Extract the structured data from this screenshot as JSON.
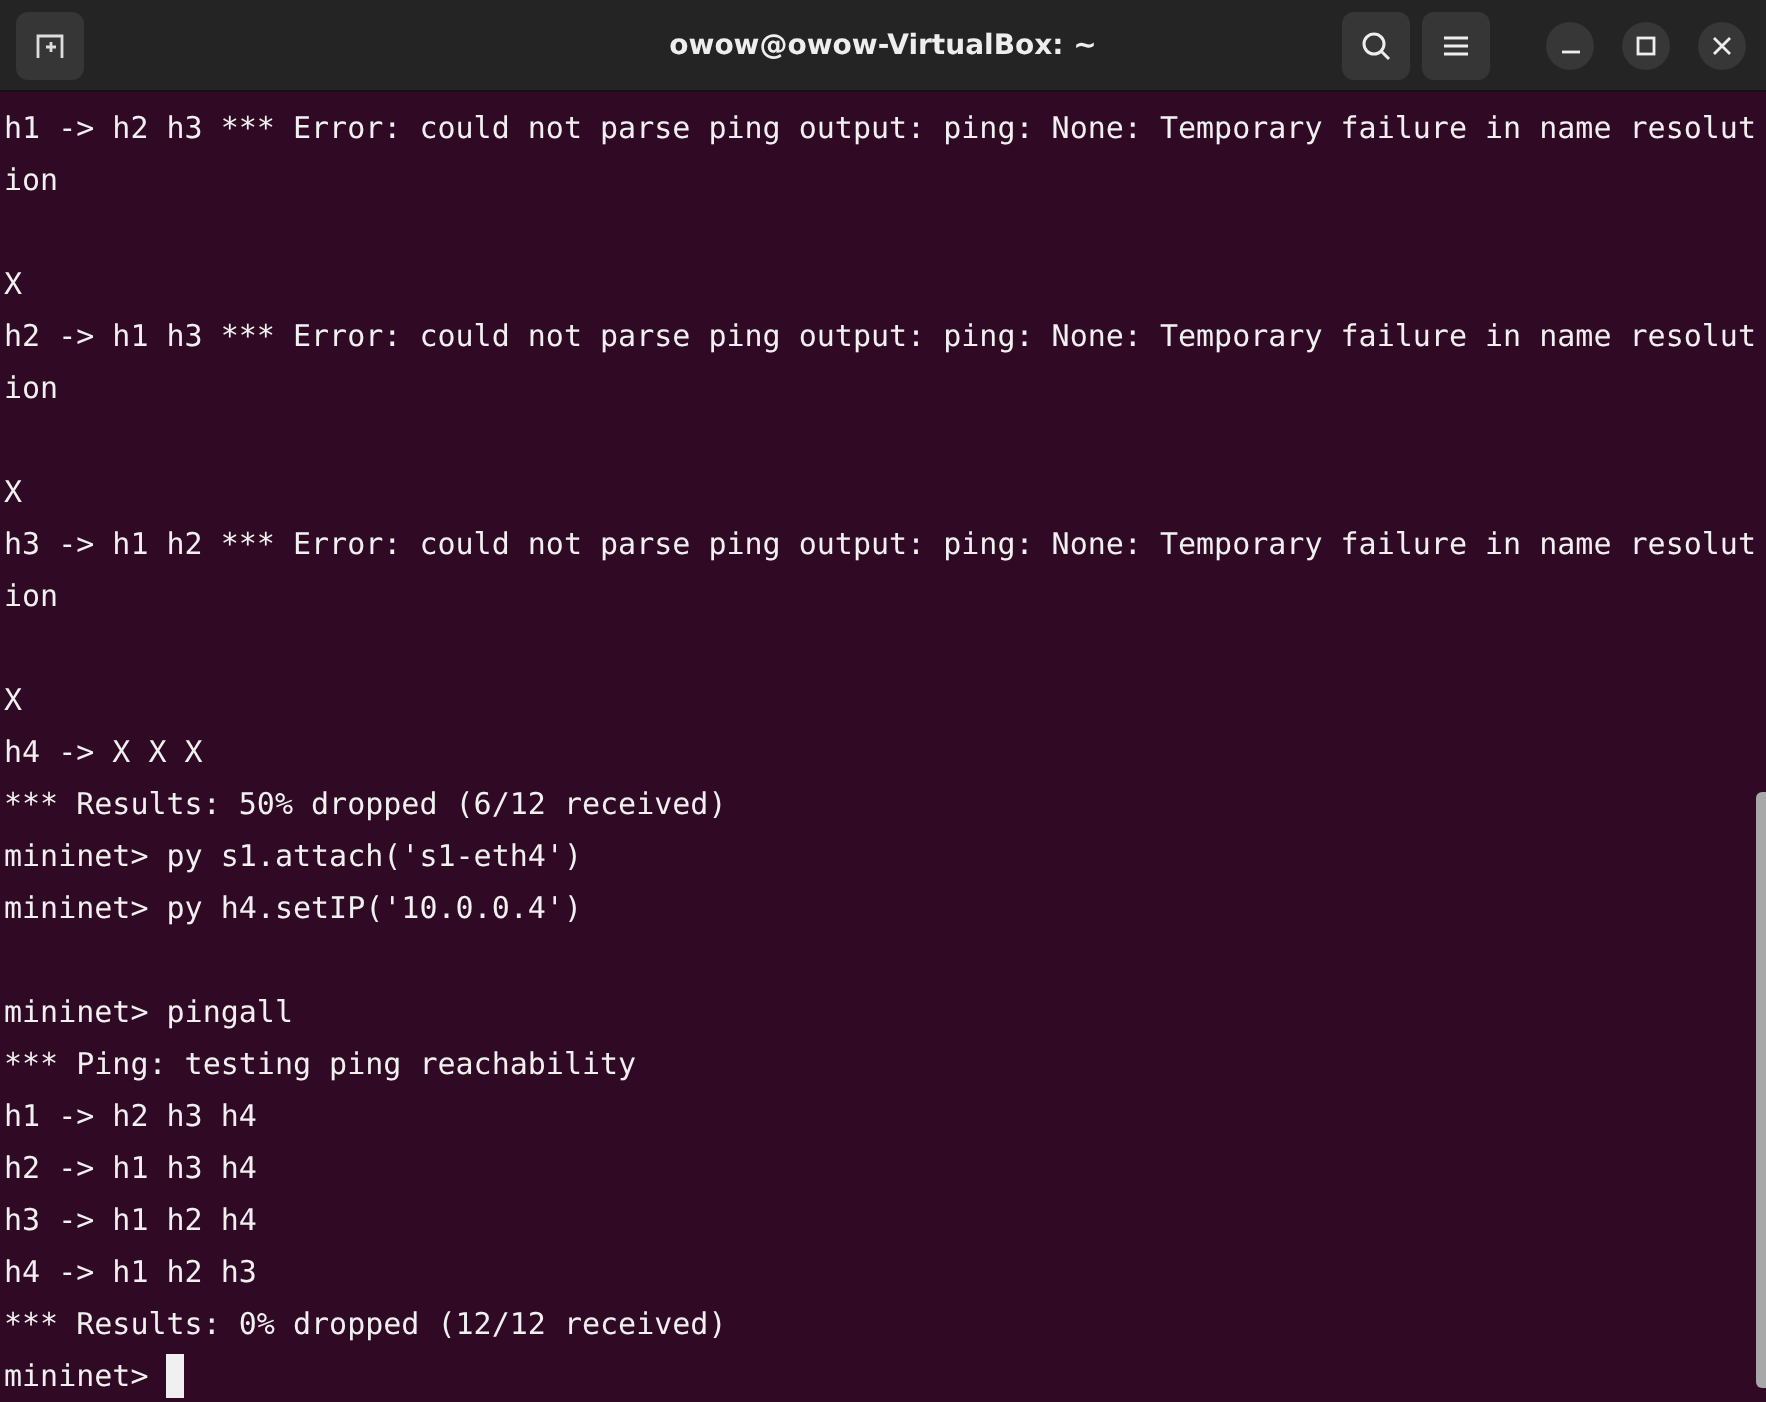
{
  "window": {
    "title": "owow@owow-VirtualBox: ~"
  },
  "terminal": {
    "blocks": [
      {
        "lines": [
          "h1 -> h2 h3 *** Error: could not parse ping output: ping: None: Temporary failure in name resolut",
          "ion"
        ]
      },
      {
        "lines": [
          "X",
          "h2 -> h1 h3 *** Error: could not parse ping output: ping: None: Temporary failure in name resolut",
          "ion"
        ]
      },
      {
        "lines": [
          "X",
          "h3 -> h1 h2 *** Error: could not parse ping output: ping: None: Temporary failure in name resolut",
          "ion"
        ]
      },
      {
        "lines": [
          "X",
          "h4 -> X X X",
          "*** Results: 50% dropped (6/12 received)",
          "mininet> py s1.attach('s1-eth4')",
          "mininet> py h4.setIP('10.0.0.4')"
        ]
      },
      {
        "lines": [
          "mininet> pingall",
          "*** Ping: testing ping reachability",
          "h1 -> h2 h3 h4",
          "h2 -> h1 h3 h4",
          "h3 -> h1 h2 h4",
          "h4 -> h1 h2 h3",
          "*** Results: 0% dropped (12/12 received)"
        ]
      }
    ],
    "prompt": {
      "text": "mininet>",
      "cursor": true
    }
  }
}
